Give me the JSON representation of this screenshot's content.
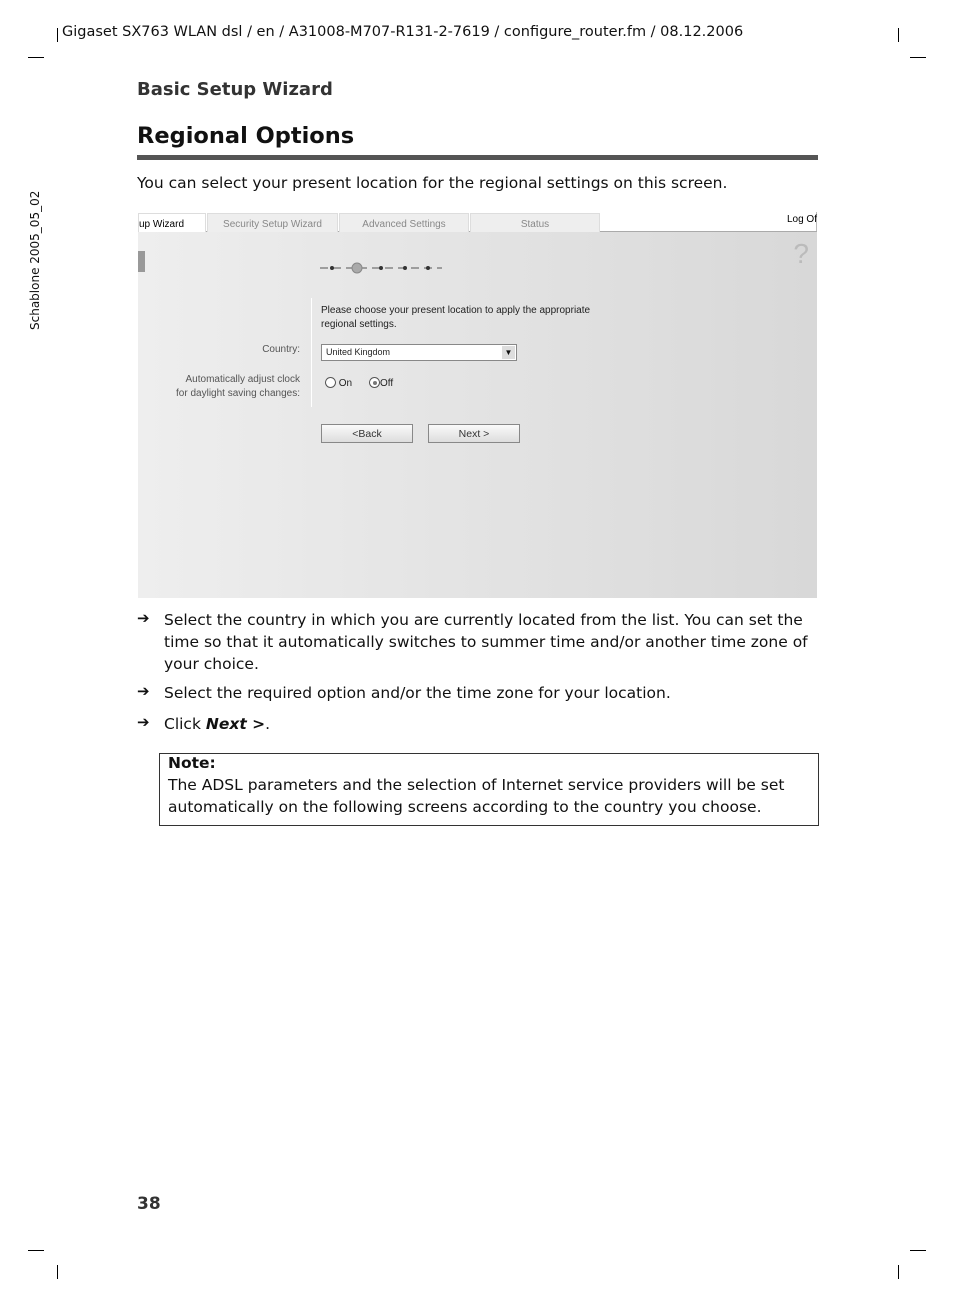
{
  "header": {
    "running_head": "Gigaset SX763 WLAN dsl / en / A31008-M707-R131-2-7619 / configure_router.fm / 08.12.2006"
  },
  "side_text": "Schablone 2005_05_02",
  "section": "Basic Setup Wizard",
  "title": "Regional Options",
  "intro": "You can select your present location for the regional settings on this screen.",
  "screenshot": {
    "tabs": [
      "up Wizard",
      "Security Setup Wizard",
      "Advanced Settings",
      "Status"
    ],
    "logoff": "Log Of",
    "help": "?",
    "instruction_line1": "Please choose your present location to apply the appropriate",
    "instruction_line2": "regional settings.",
    "country_label": "Country:",
    "country_value": "United Kingdom",
    "dst_label_line1": "Automatically adjust clock",
    "dst_label_line2": "for daylight saving changes:",
    "on_label": "On",
    "off_label": "Off",
    "selected": "Off",
    "back": "<Back",
    "next": "Next >"
  },
  "steps": [
    {
      "arrow": "➔",
      "text": "Select the country in which you are currently located from the list. You can set the time so that it automatically switches to summer time and/or another time zone of your choice."
    },
    {
      "arrow": "➔",
      "text": "Select the required option and/or the time zone for your location."
    },
    {
      "arrow": "➔",
      "pre": "Click ",
      "bold": "Next >",
      "post": "."
    }
  ],
  "note": {
    "heading": "Note:",
    "text": "The ADSL parameters and the selection of Internet service providers will be set automatically on the following screens according to the country you choose."
  },
  "page_number": "38"
}
